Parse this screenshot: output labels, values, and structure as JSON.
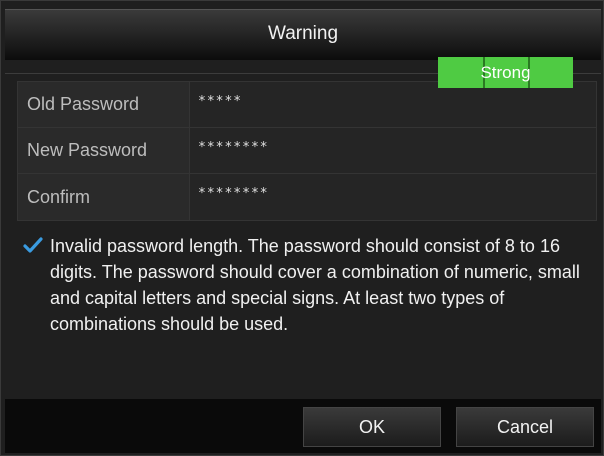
{
  "dialog": {
    "title": "Warning"
  },
  "form": {
    "rows": [
      {
        "label": "Old Password",
        "value": "*****"
      },
      {
        "label": "New Password",
        "value": "********",
        "strength": "Strong"
      },
      {
        "label": "Confirm",
        "value": "********"
      }
    ]
  },
  "notice": {
    "icon": "checkmark-icon",
    "text": "Invalid password length. The password should consist of 8 to 16 digits. The password should cover a combination of numeric, small and capital letters and special signs. At least two types of combinations should be used."
  },
  "buttons": {
    "ok": "OK",
    "cancel": "Cancel"
  },
  "colors": {
    "strength_bar": "#4fcb43",
    "checkmark": "#3a9be0"
  }
}
